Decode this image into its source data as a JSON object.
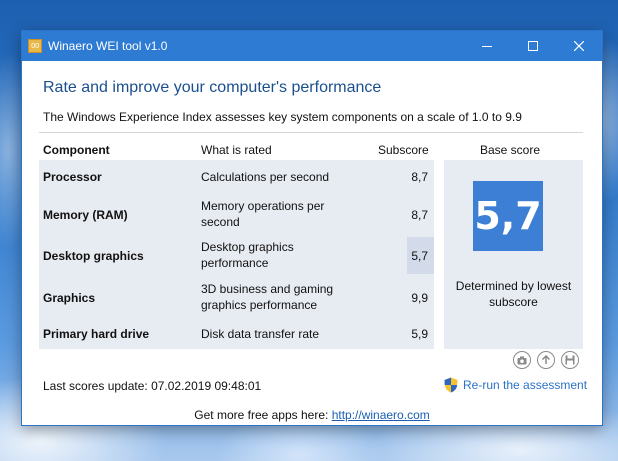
{
  "window": {
    "title": "Winaero WEI tool v1.0",
    "icon_text": "00"
  },
  "heading": "Rate and improve your computer's performance",
  "subheading": "The Windows Experience Index assesses key system components on a scale of 1.0 to 9.9",
  "table": {
    "headers": {
      "component": "Component",
      "what": "What is rated",
      "subscore": "Subscore",
      "base": "Base score"
    },
    "rows": [
      {
        "component": "Processor",
        "what": "Calculations per second",
        "subscore": "8,7"
      },
      {
        "component": "Memory (RAM)",
        "what": "Memory operations per second",
        "subscore": "8,7"
      },
      {
        "component": "Desktop graphics",
        "what": "Desktop graphics performance",
        "subscore": "5,7"
      },
      {
        "component": "Graphics",
        "what": "3D business and gaming graphics performance",
        "subscore": "9,9"
      },
      {
        "component": "Primary hard drive",
        "what": "Disk data transfer rate",
        "subscore": "5,9"
      }
    ]
  },
  "base_score": {
    "value": "5,7",
    "caption": "Determined by lowest subscore"
  },
  "status": {
    "last_update": "Last scores update: 07.02.2019 09:48:01",
    "rerun_label": "Re-run the assessment"
  },
  "footer": {
    "text": "Get more free apps here:",
    "link": "http://winaero.com"
  },
  "icons": {
    "tools": [
      "camera-icon",
      "upload-icon",
      "save-icon"
    ],
    "rerun": "uac-shield-icon"
  },
  "colors": {
    "titlebar": "#2e7bd3",
    "heading": "#1b4f8e",
    "score_tile": "#3d7fd4",
    "table_bg": "#e7ebf2",
    "link": "#2b73c4"
  }
}
